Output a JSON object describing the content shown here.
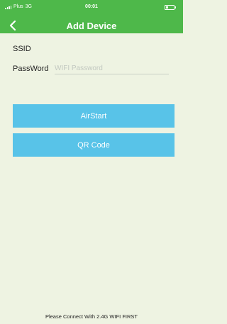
{
  "status_bar": {
    "carrier": "Plus",
    "network": "3G",
    "time": "00:01"
  },
  "header": {
    "title": "Add Device",
    "back_icon": "chevron-left-icon",
    "background_color": "#4eb84a"
  },
  "form": {
    "ssid_label": "SSID",
    "password_label": "PassWord",
    "password_placeholder": "WIFI Password",
    "password_value": ""
  },
  "buttons": {
    "airstart_label": "AirStart",
    "qr_code_label": "QR Code",
    "color": "#58c3e8"
  },
  "footer": {
    "note": "Please Connect With 2.4G WIFI FIRST"
  }
}
